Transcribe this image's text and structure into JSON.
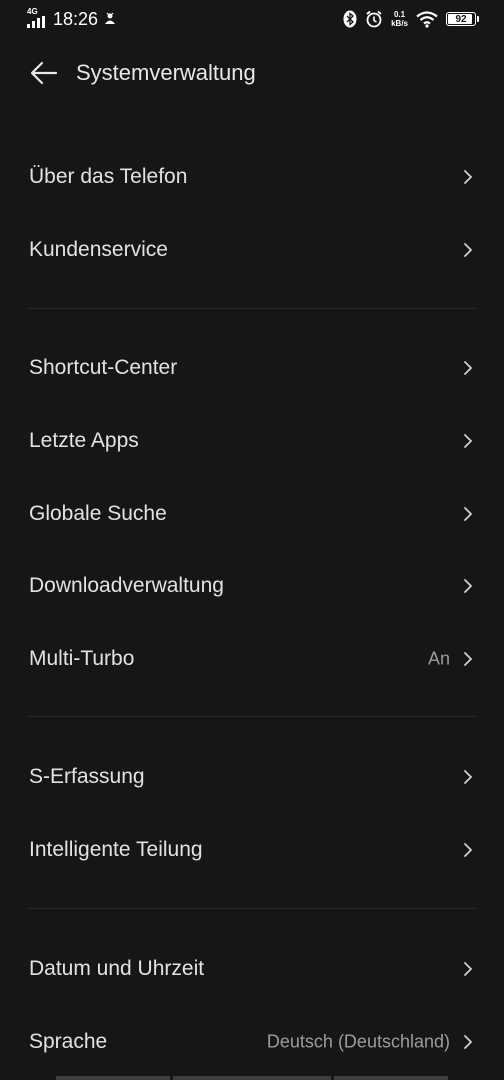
{
  "status_bar": {
    "network": "4G",
    "time": "18:26",
    "speed_value": "0.1",
    "speed_unit": "kB/s",
    "battery": "92",
    "battery_level": 0.92
  },
  "header": {
    "title": "Systemverwaltung"
  },
  "sections": {
    "s1": [
      {
        "label": "Über das Telefon"
      },
      {
        "label": "Kundenservice"
      }
    ],
    "s2": [
      {
        "label": "Shortcut-Center"
      },
      {
        "label": "Letzte Apps"
      },
      {
        "label": "Globale Suche"
      },
      {
        "label": "Downloadverwaltung"
      },
      {
        "label": "Multi-Turbo",
        "value": "An"
      }
    ],
    "s3": [
      {
        "label": "S-Erfassung"
      },
      {
        "label": "Intelligente Teilung"
      }
    ],
    "s4": [
      {
        "label": "Datum und Uhrzeit"
      },
      {
        "label": "Sprache",
        "value": "Deutsch (Deutschland)"
      }
    ]
  },
  "colors": {
    "background": "#161616",
    "text": "#e2e2e2",
    "secondary_text": "#9c9c9c",
    "divider": "#2a2a2a"
  }
}
